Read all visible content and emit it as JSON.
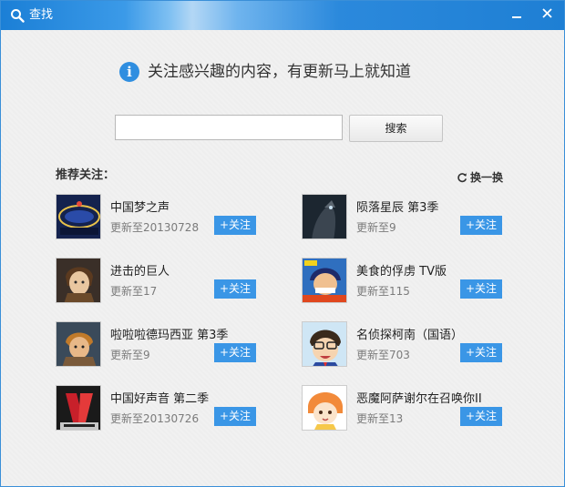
{
  "window": {
    "title": "查找",
    "minimize": "—",
    "close": "✕"
  },
  "info": {
    "text": "关注感兴趣的内容，有更新马上就知道",
    "icon": "info-icon"
  },
  "search": {
    "value": "",
    "placeholder": "",
    "button_label": "搜索"
  },
  "recommend": {
    "title": "推荐关注：",
    "refresh_label": "换一换",
    "items": [
      {
        "name": "中国梦之声",
        "update": "更新至20130728",
        "follow_label": "+关注"
      },
      {
        "name": "陨落星辰 第3季",
        "update": "更新至9",
        "follow_label": "+关注"
      },
      {
        "name": "进击的巨人",
        "update": "更新至17",
        "follow_label": "+关注"
      },
      {
        "name": "美食的俘虏 TV版",
        "update": "更新至115",
        "follow_label": "+关注"
      },
      {
        "name": "啦啦啦德玛西亚 第3季",
        "update": "更新至9",
        "follow_label": "+关注"
      },
      {
        "name": "名侦探柯南（国语）",
        "update": "更新至703",
        "follow_label": "+关注"
      },
      {
        "name": "中国好声音 第二季",
        "update": "更新至20130726",
        "follow_label": "+关注"
      },
      {
        "name": "恶魔阿萨谢尔在召唤你II",
        "update": "更新至13",
        "follow_label": "+关注"
      }
    ]
  },
  "colors": {
    "accent": "#3a96e6",
    "titlebar": "#1e7fd4"
  }
}
